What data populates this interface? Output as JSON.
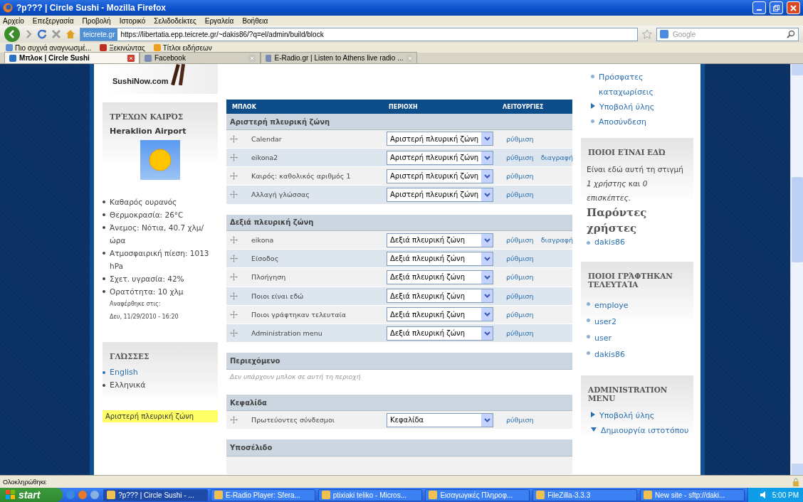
{
  "window": {
    "title": "?p??? | Circle Sushi - Mozilla Firefox"
  },
  "menu": [
    "Αρχείο",
    "Επεξεργασία",
    "Προβολή",
    "Ιστορικό",
    "Σελιδοδείκτες",
    "Εργαλεία",
    "Βοήθεια"
  ],
  "address": {
    "site_badge": "teicrete.gr",
    "url": "https://libertatia.epp.teicrete.gr/~dakis86/?q=el/admin/build/block"
  },
  "search": {
    "placeholder": "Google"
  },
  "bookmarks": [
    "Πιο συχνά αναγνωσμέ...",
    "Ξεκινώντας",
    "Τίτλοι ειδήσεων"
  ],
  "tabs": [
    {
      "label": "Μπλοκ | Circle Sushi",
      "selected": true
    },
    {
      "label": "Facebook",
      "selected": false
    },
    {
      "label": "E-Radio.gr | Listen to Athens live radio ...",
      "selected": false
    }
  ],
  "left_sidebar": {
    "logo": "SushiNow.com",
    "weather": {
      "title": "ΤΡΈΧΩΝ ΚΑΙΡΌΣ",
      "station": "Heraklion Airport",
      "items": [
        "Καθαρός ουρανός",
        "Θερμοκρασία: 26°C",
        "Άνεμος: Νότια, 40.7 χλμ/ώρα",
        "Ατμοσφαιρική πίεση: 1013 hPa",
        "Σχετ. υγρασία: 42%",
        "Ορατότητα: 10 χλμ"
      ],
      "reported_label": "Αναφέρθηκε στις:",
      "reported_time": "Δευ, 11/29/2010 - 16:20"
    },
    "languages": {
      "title": "ΓΛΏΣΣΕΣ",
      "items": [
        {
          "label": "English",
          "selected": false
        },
        {
          "label": "Ελληνικά",
          "selected": true
        }
      ]
    },
    "region_label": "Αριστερή πλευρική ζώνη"
  },
  "blocks_table": {
    "columns": [
      "ΜΠΛΟΚ",
      "ΠΕΡΙΟΧΗ",
      "ΛΕΙΤΟΥΡΓΙΕΣ"
    ],
    "regions": [
      {
        "title": "Αριστερή πλευρική ζώνη",
        "rows": [
          {
            "name": "Calendar",
            "region": "Αριστερή πλευρική ζώνη",
            "actions": [
              "ρύθμιση"
            ]
          },
          {
            "name": "eikona2",
            "region": "Αριστερή πλευρική ζώνη",
            "actions": [
              "ρύθμιση",
              "διαγραφή"
            ]
          },
          {
            "name": "Καιρός: καθολικός αριθμός 1",
            "region": "Αριστερή πλευρική ζώνη",
            "actions": [
              "ρύθμιση"
            ]
          },
          {
            "name": "Αλλαγή γλώσσας",
            "region": "Αριστερή πλευρική ζώνη",
            "actions": [
              "ρύθμιση"
            ]
          }
        ]
      },
      {
        "title": "Δεξιά πλευρική ζώνη",
        "rows": [
          {
            "name": "eikona",
            "region": "Δεξιά πλευρική ζώνη",
            "actions": [
              "ρύθμιση",
              "διαγραφή"
            ]
          },
          {
            "name": "Είσοδος",
            "region": "Δεξιά πλευρική ζώνη",
            "actions": [
              "ρύθμιση"
            ]
          },
          {
            "name": "Πλοήγηση",
            "region": "Δεξιά πλευρική ζώνη",
            "actions": [
              "ρύθμιση"
            ]
          },
          {
            "name": "Ποιοι είναι εδώ",
            "region": "Δεξιά πλευρική ζώνη",
            "actions": [
              "ρύθμιση"
            ]
          },
          {
            "name": "Ποιοι γράφτηκαν τελευταία",
            "region": "Δεξιά πλευρική ζώνη",
            "actions": [
              "ρύθμιση"
            ]
          },
          {
            "name": "Administration menu",
            "region": "Δεξιά πλευρική ζώνη",
            "actions": [
              "ρύθμιση"
            ]
          }
        ]
      },
      {
        "title": "Περιεχόμενο",
        "empty_text": "Δεν υπάρχουν μπλοκ σε αυτή τη περιοχή"
      },
      {
        "title": "Κεφαλίδα",
        "rows": [
          {
            "name": "Πρωτεύοντες σύνδεσμοι",
            "region": "Κεφαλίδα",
            "actions": [
              "ρύθμιση"
            ]
          }
        ]
      },
      {
        "title": "Υποσέλιδο",
        "cut_row": true
      }
    ]
  },
  "right_sidebar": {
    "navigation": [
      {
        "label": "Πρόσφατες καταχωρίσεις",
        "kind": "leaf"
      },
      {
        "label": "Υποβολή ύλης",
        "kind": "collapsed"
      },
      {
        "label": "Αποσύνδεση",
        "kind": "leaf"
      }
    ],
    "whos_online": {
      "title": "ΠΟΙΟΙ ΕΊΝΑΙ ΕΔΏ",
      "text": "Είναι εδώ αυτή τη στιγμή *1 χρήστης* και *0 επισκέπτες*.",
      "heading": "Παρόντες χρήστες",
      "users": [
        "dakis86"
      ]
    },
    "recent_users": {
      "title": "ΠΟΙΟΙ ΓΡΆΦΤΗΚΑΝ ΤΕΛΕΥΤΑΊΑ",
      "users": [
        "employe",
        "user2",
        "user",
        "dakis86"
      ]
    },
    "admin_menu": {
      "title": "ADMINISTRATION MENU",
      "items": [
        {
          "label": "Υποβολή ύλης",
          "kind": "collapsed"
        },
        {
          "label": "Δημιουργία ιστοτόπου",
          "kind": "expanded"
        }
      ]
    }
  },
  "status_bar": {
    "text": "Ολοκληρώθηκε"
  },
  "taskbar": {
    "start": "start",
    "tasks": [
      {
        "label": "?p??? | Circle Sushi - ...",
        "selected": true
      },
      {
        "label": "E-Radio Player: Sfera...",
        "selected": false
      },
      {
        "label": "ptixiaki teliko - Micros...",
        "selected": false
      },
      {
        "label": "Εισαγωγικές Πληροφ...",
        "selected": false
      },
      {
        "label": "FileZilla-3.3.3",
        "selected": false
      },
      {
        "label": "New site - sftp://daki...",
        "selected": false
      }
    ],
    "clock": "5:00 PM"
  }
}
